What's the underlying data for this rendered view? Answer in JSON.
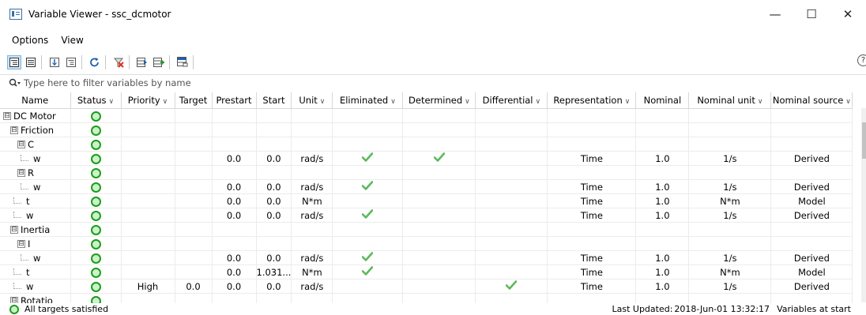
{
  "window": {
    "title": "Variable Viewer - ssc_dcmotor",
    "minimize": "—",
    "maximize": "☐",
    "close": "✕"
  },
  "menu": [
    {
      "label": "Options"
    },
    {
      "label": "View"
    }
  ],
  "toolbar": {
    "icons": [
      "tree-view-icon",
      "flat-list-icon",
      "collapse-all-icon",
      "expand-all-icon",
      "refresh-icon",
      "clear-targets-icon",
      "import-icon",
      "export-icon",
      "show-columns-icon"
    ],
    "help": "?"
  },
  "filter": {
    "placeholder": "Type here to filter variables by name"
  },
  "columns": [
    {
      "label": "Name",
      "chevron": false
    },
    {
      "label": "Status",
      "chevron": true
    },
    {
      "label": "Priority",
      "chevron": true
    },
    {
      "label": "Target",
      "chevron": false
    },
    {
      "label": "Prestart",
      "chevron": false
    },
    {
      "label": "Start",
      "chevron": false
    },
    {
      "label": "Unit",
      "chevron": true
    },
    {
      "label": "Eliminated",
      "chevron": true
    },
    {
      "label": "Determined",
      "chevron": true
    },
    {
      "label": "Differential",
      "chevron": true
    },
    {
      "label": "Representation",
      "chevron": true
    },
    {
      "label": "Nominal",
      "chevron": false
    },
    {
      "label": "Nominal unit",
      "chevron": true
    },
    {
      "label": "Nominal source",
      "chevron": true
    }
  ],
  "rows": [
    {
      "name": "DC Motor",
      "level": 0,
      "kind": "group",
      "expander": "⊟",
      "priority": "",
      "target": "",
      "prestart": "",
      "start": "",
      "unit": "",
      "eliminated": false,
      "determined": false,
      "differential": false,
      "representation": "",
      "nominal": "",
      "nominal_unit": "",
      "nominal_source": ""
    },
    {
      "name": "Friction",
      "level": 1,
      "kind": "group",
      "expander": "⊟",
      "priority": "",
      "target": "",
      "prestart": "",
      "start": "",
      "unit": "",
      "eliminated": false,
      "determined": false,
      "differential": false,
      "representation": "",
      "nominal": "",
      "nominal_unit": "",
      "nominal_source": ""
    },
    {
      "name": "C",
      "level": 2,
      "kind": "group",
      "expander": "⊟",
      "priority": "",
      "target": "",
      "prestart": "",
      "start": "",
      "unit": "",
      "eliminated": false,
      "determined": false,
      "differential": false,
      "representation": "",
      "nominal": "",
      "nominal_unit": "",
      "nominal_source": ""
    },
    {
      "name": "w",
      "level": 3,
      "kind": "leaf",
      "expander": "",
      "priority": "",
      "target": "",
      "prestart": "0.0",
      "start": "0.0",
      "unit": "rad/s",
      "eliminated": true,
      "determined": true,
      "differential": false,
      "representation": "Time",
      "nominal": "1.0",
      "nominal_unit": "1/s",
      "nominal_source": "Derived"
    },
    {
      "name": "R",
      "level": 2,
      "kind": "group",
      "expander": "⊟",
      "priority": "",
      "target": "",
      "prestart": "",
      "start": "",
      "unit": "",
      "eliminated": false,
      "determined": false,
      "differential": false,
      "representation": "",
      "nominal": "",
      "nominal_unit": "",
      "nominal_source": ""
    },
    {
      "name": "w",
      "level": 3,
      "kind": "leaf",
      "expander": "",
      "priority": "",
      "target": "",
      "prestart": "0.0",
      "start": "0.0",
      "unit": "rad/s",
      "eliminated": true,
      "determined": false,
      "differential": false,
      "representation": "Time",
      "nominal": "1.0",
      "nominal_unit": "1/s",
      "nominal_source": "Derived"
    },
    {
      "name": "t",
      "level": 2,
      "kind": "leaf",
      "expander": "",
      "priority": "",
      "target": "",
      "prestart": "0.0",
      "start": "0.0",
      "unit": "N*m",
      "eliminated": false,
      "determined": false,
      "differential": false,
      "representation": "Time",
      "nominal": "1.0",
      "nominal_unit": "N*m",
      "nominal_source": "Model"
    },
    {
      "name": "w",
      "level": 2,
      "kind": "leaf",
      "expander": "",
      "priority": "",
      "target": "",
      "prestart": "0.0",
      "start": "0.0",
      "unit": "rad/s",
      "eliminated": true,
      "determined": false,
      "differential": false,
      "representation": "Time",
      "nominal": "1.0",
      "nominal_unit": "1/s",
      "nominal_source": "Derived"
    },
    {
      "name": "Inertia",
      "level": 1,
      "kind": "group",
      "expander": "⊟",
      "priority": "",
      "target": "",
      "prestart": "",
      "start": "",
      "unit": "",
      "eliminated": false,
      "determined": false,
      "differential": false,
      "representation": "",
      "nominal": "",
      "nominal_unit": "",
      "nominal_source": ""
    },
    {
      "name": "I",
      "level": 2,
      "kind": "group",
      "expander": "⊟",
      "priority": "",
      "target": "",
      "prestart": "",
      "start": "",
      "unit": "",
      "eliminated": false,
      "determined": false,
      "differential": false,
      "representation": "",
      "nominal": "",
      "nominal_unit": "",
      "nominal_source": ""
    },
    {
      "name": "w",
      "level": 3,
      "kind": "leaf",
      "expander": "",
      "priority": "",
      "target": "",
      "prestart": "0.0",
      "start": "0.0",
      "unit": "rad/s",
      "eliminated": true,
      "determined": false,
      "differential": false,
      "representation": "Time",
      "nominal": "1.0",
      "nominal_unit": "1/s",
      "nominal_source": "Derived"
    },
    {
      "name": "t",
      "level": 2,
      "kind": "leaf",
      "expander": "",
      "priority": "",
      "target": "",
      "prestart": "0.0",
      "start": "1.031...",
      "unit": "N*m",
      "eliminated": true,
      "determined": false,
      "differential": false,
      "representation": "Time",
      "nominal": "1.0",
      "nominal_unit": "N*m",
      "nominal_source": "Model"
    },
    {
      "name": "w",
      "level": 2,
      "kind": "leaf",
      "expander": "",
      "priority": "High",
      "target": "0.0",
      "prestart": "0.0",
      "start": "0.0",
      "unit": "rad/s",
      "eliminated": false,
      "determined": false,
      "differential": true,
      "representation": "Time",
      "nominal": "1.0",
      "nominal_unit": "1/s",
      "nominal_source": "Derived"
    },
    {
      "name": "Rotatio",
      "level": 1,
      "kind": "group",
      "expander": "⊟",
      "priority": "",
      "target": "",
      "prestart": "",
      "start": "",
      "unit": "",
      "eliminated": false,
      "determined": false,
      "differential": false,
      "representation": "",
      "nominal": "",
      "nominal_unit": "",
      "nominal_source": ""
    }
  ],
  "statusbar": {
    "left": "All targets satisfied",
    "last_updated_label": "Last Updated:",
    "last_updated_value": "2018-Jun-01 13:32:17",
    "mode": "Variables at start"
  },
  "colors": {
    "status_ring": "#1e9b1e",
    "status_fill": "#c9f4c9",
    "check": "#5cb85c"
  }
}
